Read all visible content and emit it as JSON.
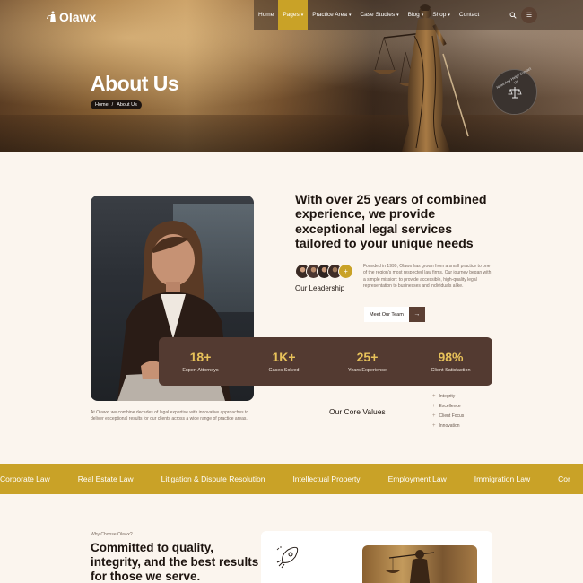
{
  "brand": {
    "name": "Olawx"
  },
  "nav": {
    "items": [
      {
        "label": "Home",
        "caret": false,
        "active": false
      },
      {
        "label": "Pages",
        "caret": true,
        "active": true
      },
      {
        "label": "Practice Area",
        "caret": true,
        "active": false
      },
      {
        "label": "Case Studies",
        "caret": true,
        "active": false
      },
      {
        "label": "Blog",
        "caret": true,
        "active": false
      },
      {
        "label": "Shop",
        "caret": true,
        "active": false
      },
      {
        "label": "Contact",
        "caret": false,
        "active": false
      }
    ],
    "search_icon": "search-icon",
    "menu_icon": "menu-icon"
  },
  "hero": {
    "title": "About Us",
    "breadcrumb": {
      "home": "Home",
      "separator": "/",
      "current": "About Us"
    },
    "stamp_text": "Need Any Help? Contact Us"
  },
  "about": {
    "heading": "With over 25 years of combined experience, we provide exceptional legal services tailored to your unique needs",
    "leadership_label": "Our Leadership",
    "avatar_plus": "+",
    "paragraph": "Founded in 1999, Olawx has grown from a small practice to one of the region's most respected law firms. Our journey began with a simple mission: to provide accessible, high-quality legal representation to businesses and individuals alike.",
    "team_button": "Meet Our Team",
    "team_button_arrow": "→",
    "intro": "At Olawx, we combine decades of legal expertise with innovative approaches to deliver exceptional results for our clients across a wide range of practice areas."
  },
  "stats": [
    {
      "value": "18+",
      "label": "Expert Attorneys"
    },
    {
      "value": "1K+",
      "label": "Cases Solved"
    },
    {
      "value": "25+",
      "label": "Years Experience"
    },
    {
      "value": "98%",
      "label": "Client Satisfaction"
    }
  ],
  "core_values": {
    "title": "Our Core Values",
    "items": [
      "Integrity",
      "Excellence",
      "Client Focus",
      "Innovation"
    ]
  },
  "marquee": [
    "Corporate Law",
    "Real Estate Law",
    "Litigation & Dispute Resolution",
    "Intellectual Property",
    "Employment Law",
    "Immigration Law",
    "Cor"
  ],
  "why": {
    "label": "Why Choose Olawx?",
    "heading": "Committed to quality, integrity, and the best results for those we serve."
  },
  "colors": {
    "accent_gold": "#c9a227",
    "brown_dark": "#533a31",
    "cream_bg": "#fbf5ee",
    "stat_value": "#e8c25a"
  }
}
